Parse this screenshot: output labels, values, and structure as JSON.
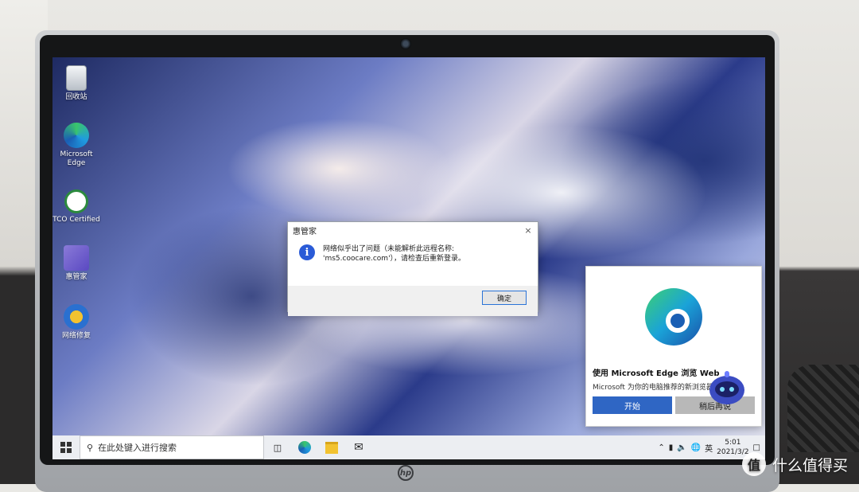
{
  "desktop": {
    "icons": [
      {
        "label": "回收站"
      },
      {
        "label": "Microsoft Edge"
      },
      {
        "label": "TCO Certified"
      },
      {
        "label": "惠管家"
      },
      {
        "label": "网络修复"
      }
    ]
  },
  "dialog": {
    "title": "惠管家",
    "close": "×",
    "message": "网络似乎出了问题（未能解析此远程名称: 'ms5.coocare.com'），请检查后重新登录。",
    "ok_label": "确定"
  },
  "edge_popup": {
    "title": "使用 Microsoft Edge 浏览 Web",
    "description": "Microsoft 为你的电脑推荐的新浏览器",
    "primary_label": "开始",
    "secondary_label": "稍后再说"
  },
  "taskbar": {
    "search_placeholder": "在此处键入进行搜索",
    "tray_lang": "英",
    "clock_time": "5:01",
    "clock_date": "2021/3/2"
  },
  "device": {
    "brand": "hp"
  },
  "watermark": {
    "circle": "值",
    "text": "什么值得买"
  }
}
